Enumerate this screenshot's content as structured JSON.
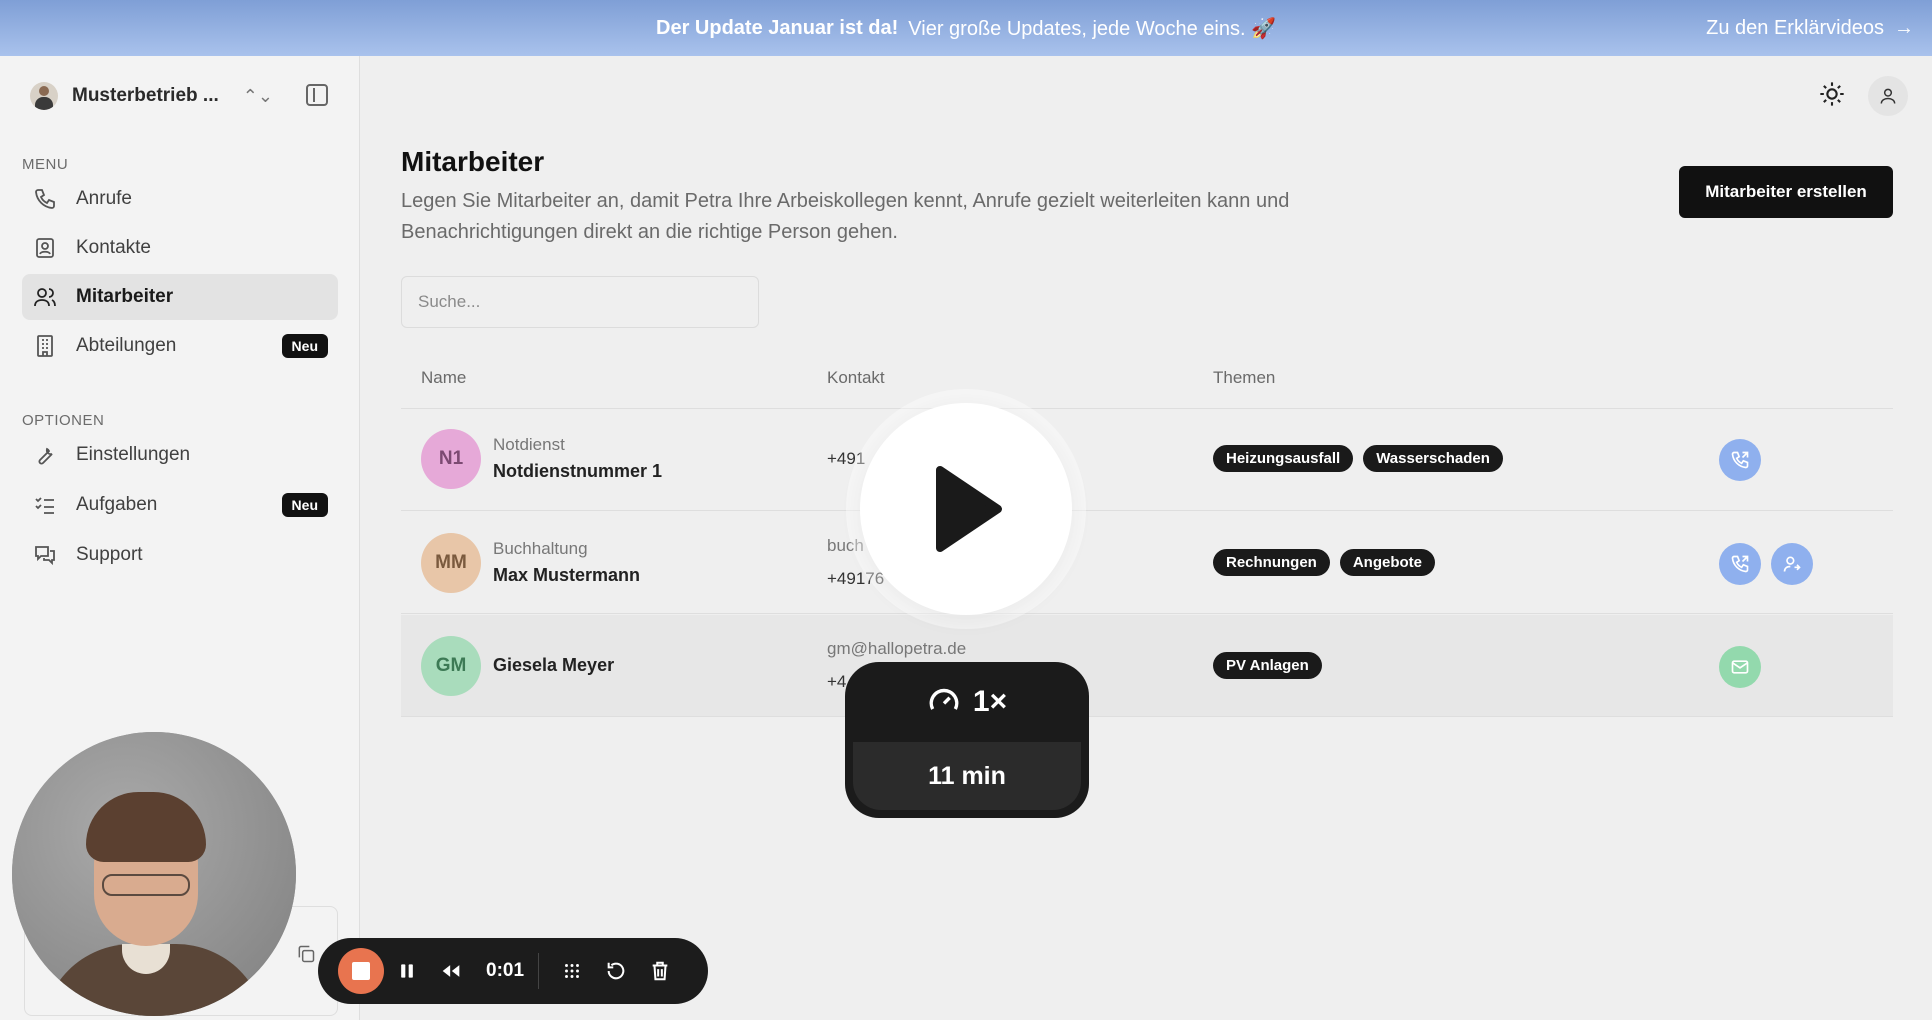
{
  "banner": {
    "headline": "Der Update Januar ist da!",
    "message": "Vier große Updates, jede Woche eins. 🚀",
    "link": "Zu den Erklärvideos",
    "arrow": "→"
  },
  "sidebar": {
    "org_name": "Musterbetrieb ...",
    "menu_label": "MENU",
    "options_label": "OPTIONEN",
    "menu_items": [
      {
        "label": "Anrufe",
        "icon": "phone-icon"
      },
      {
        "label": "Kontakte",
        "icon": "contact-card-icon"
      },
      {
        "label": "Mitarbeiter",
        "icon": "users-icon",
        "active": true
      },
      {
        "label": "Abteilungen",
        "icon": "building-icon",
        "badge": "Neu"
      }
    ],
    "option_items": [
      {
        "label": "Einstellungen",
        "icon": "wrench-icon"
      },
      {
        "label": "Aufgaben",
        "icon": "checklist-icon",
        "badge": "Neu"
      },
      {
        "label": "Support",
        "icon": "chat-icon"
      }
    ]
  },
  "main": {
    "title": "Mitarbeiter",
    "description": "Legen Sie Mitarbeiter an, damit Petra Ihre Arbeiskollegen kennt, Anrufe gezielt weiterleiten kann und Benachrichtigungen direkt an die richtige Person gehen.",
    "create_button": "Mitarbeiter erstellen",
    "search_placeholder": "Suche...",
    "columns": [
      "Name",
      "Kontakt",
      "Themen"
    ],
    "rows": [
      {
        "initials": "N1",
        "avatar_color": "#e6a9d8",
        "initials_color": "#7c4a72",
        "department": "Notdienst",
        "name": "Notdienstnummer 1",
        "contact_lines": [
          "+491"
        ],
        "tags": [
          "Heizungsausfall",
          "Wasserschaden"
        ],
        "actions": [
          "phone-forward-icon"
        ]
      },
      {
        "initials": "MM",
        "avatar_color": "#e8c6a8",
        "initials_color": "#7a5a3e",
        "department": "Buchhaltung",
        "name": "Max Mustermann",
        "contact_lines": [
          "buch",
          "+49176"
        ],
        "tags": [
          "Rechnungen",
          "Angebote"
        ],
        "actions": [
          "phone-forward-icon",
          "user-forward-icon"
        ]
      },
      {
        "initials": "GM",
        "avatar_color": "#a9dcbc",
        "initials_color": "#3d7a55",
        "department": "",
        "name": "Giesela Meyer",
        "contact_lines": [
          "gm@hallopetra.de",
          "+4"
        ],
        "tags": [
          "PV Anlagen"
        ],
        "actions": [
          "mail-icon"
        ]
      }
    ]
  },
  "video": {
    "speed": "1×",
    "duration": "11 min"
  },
  "recorder": {
    "time": "0:01"
  }
}
